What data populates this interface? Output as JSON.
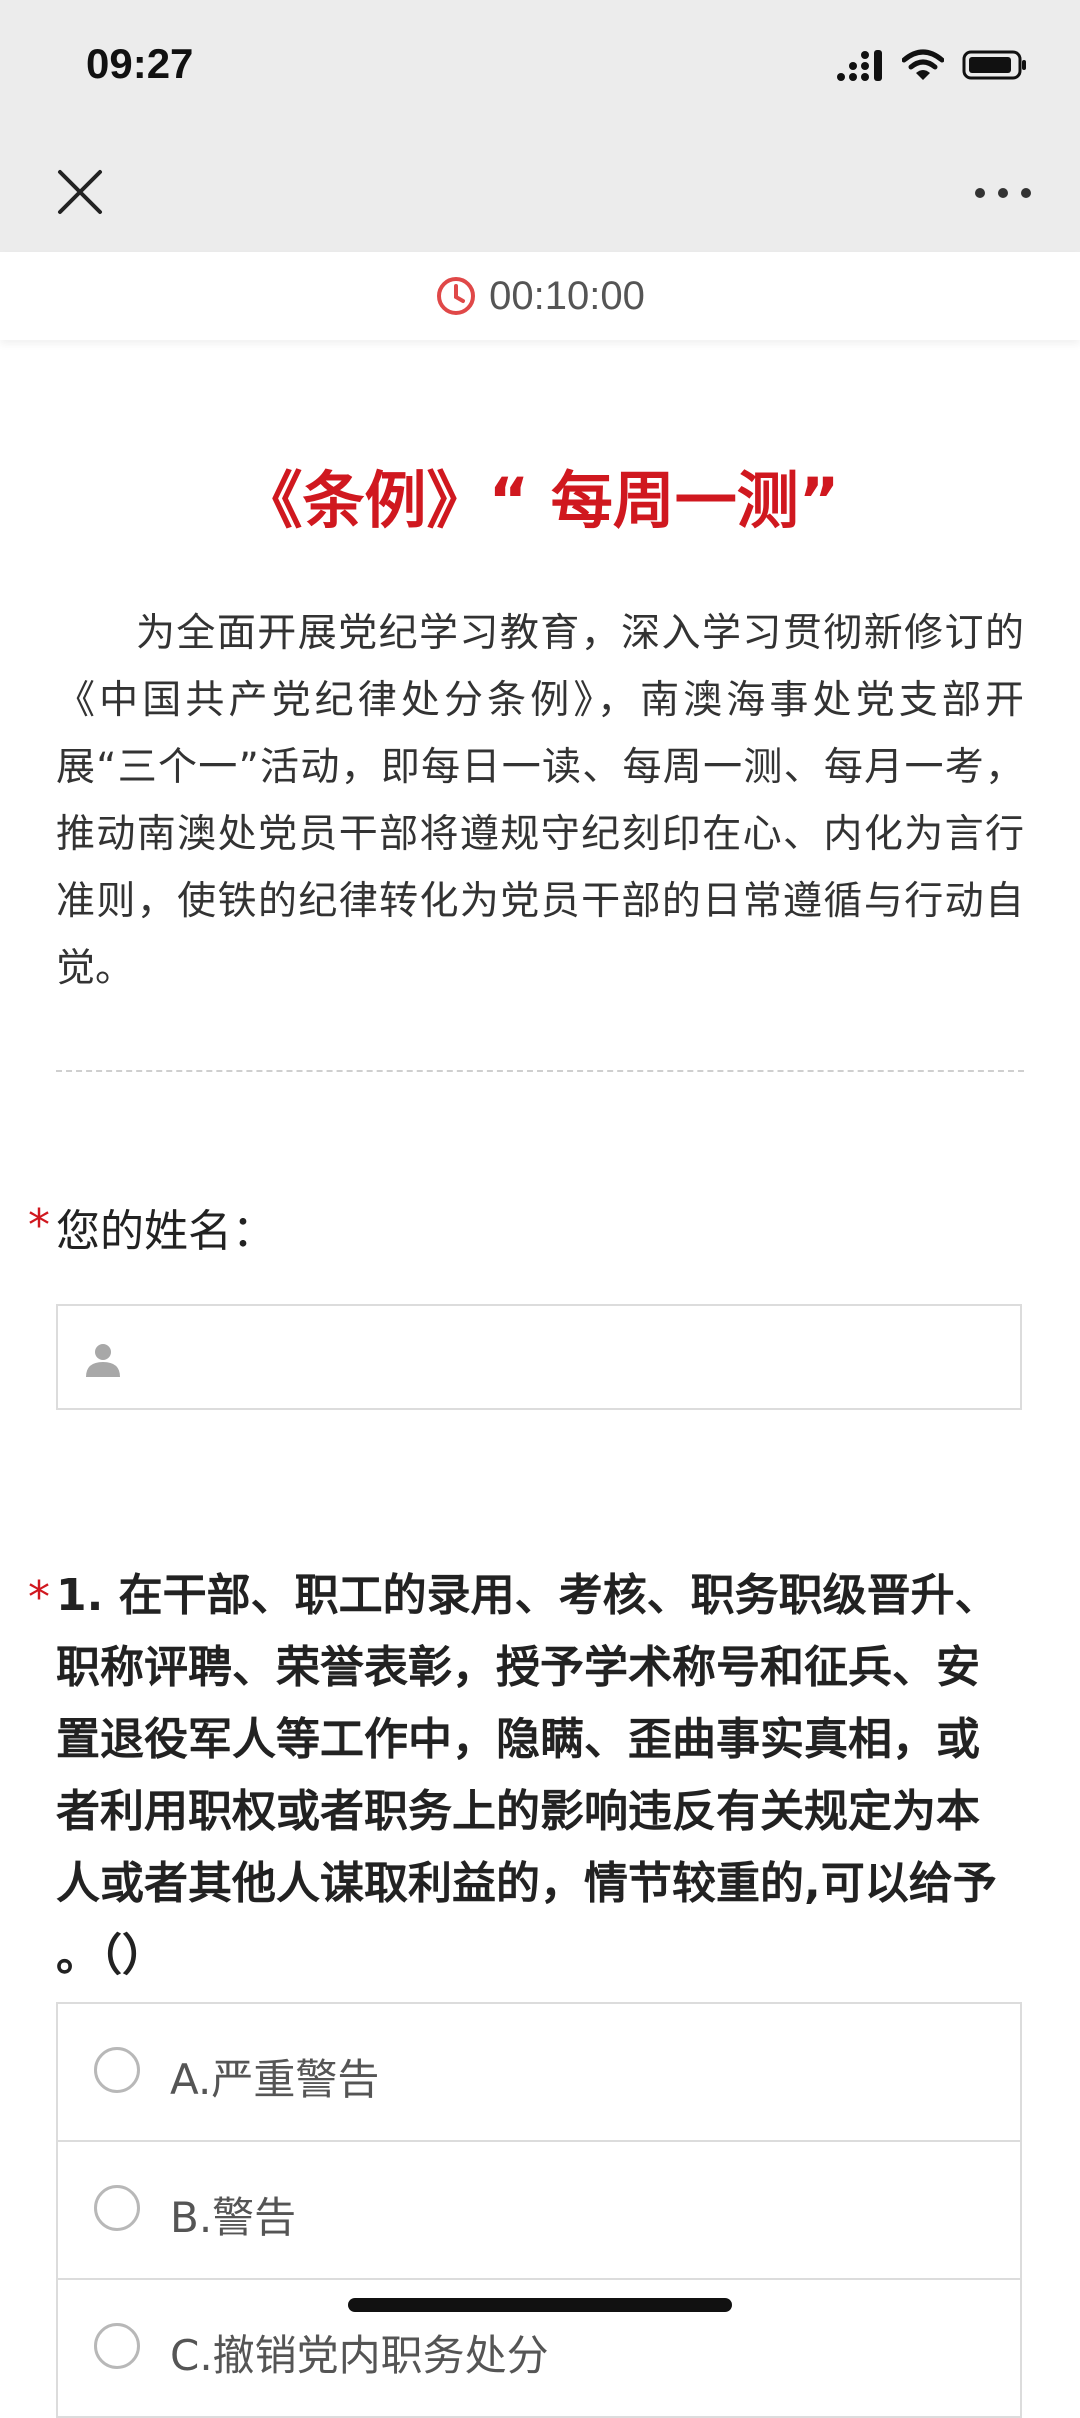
{
  "status_bar": {
    "time": "09:27"
  },
  "timer": {
    "value": "00:10:00"
  },
  "page": {
    "title": "《条例》“ 每周一测”",
    "intro": "为全面开展党纪学习教育，深入学习贯彻新修订的《中国共产党纪律处分条例》，南澳海事处党支部开展“三个一”活动，即每日一读、每周一测、每月一考，推动南澳处党员干部将遵规守纪刻印在心、内化为言行准则，使铁的纪律转化为党员干部的日常遵循与行动自觉。"
  },
  "name_field": {
    "required_mark": "*",
    "label": "您的姓名：",
    "value": ""
  },
  "question1": {
    "required_mark": "*",
    "text": "1. 在干部、职工的录用、考核、职务职级晋升、职称评聘、荣誉表彰，授予学术称号和征兵、安置退役军人等工作中，隐瞒、歪曲事实真相，或者利用职权或者职务上的影响违反有关规定为本人或者其他人谋取利益的，情节较重的,可以给予 。（）",
    "options": [
      {
        "label": "A.严重警告"
      },
      {
        "label": "B.警告"
      },
      {
        "label": "C.撤销党内职务处分"
      }
    ]
  },
  "colors": {
    "accent_red": "#d0181f",
    "bar_gray": "#ececec"
  }
}
